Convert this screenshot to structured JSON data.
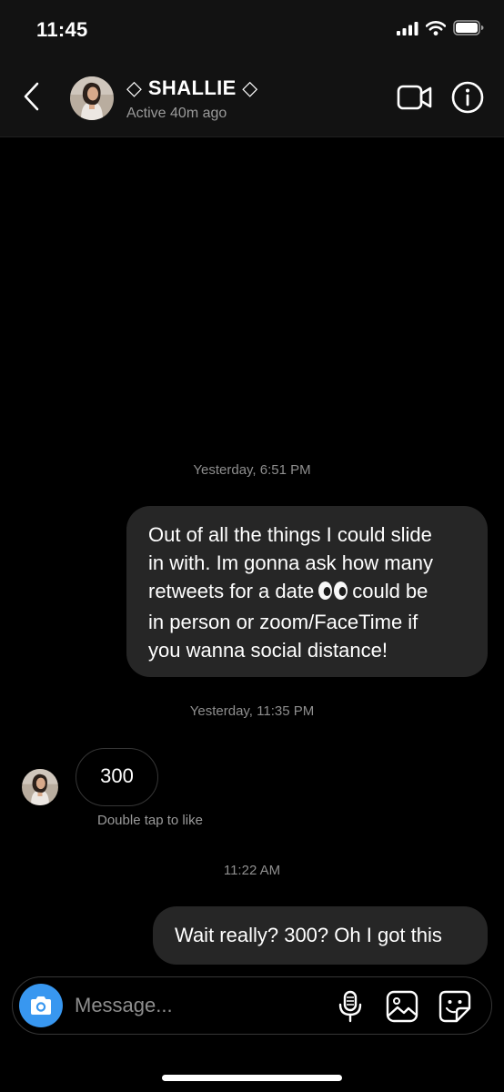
{
  "status_bar": {
    "time": "11:45",
    "icons": [
      "cellular-signal-icon",
      "wifi-icon",
      "battery-icon"
    ]
  },
  "header": {
    "back_icon": "chevron-left-icon",
    "name": "◇ SHALLIE ◇",
    "status": "Active 40m ago",
    "video_icon": "video-camera-icon",
    "info_icon": "info-icon"
  },
  "conversation": {
    "timestamps": [
      "Yesterday, 6:51 PM",
      "Yesterday, 11:35 PM",
      "11:22 AM"
    ],
    "messages": [
      {
        "sender": "me",
        "lines": [
          "Out of all the things I could slide",
          "in with. Im gonna ask how many",
          "retweets for a date",
          "could be",
          "in person or zoom/FaceTime if",
          "you wanna social distance!"
        ],
        "emoji": "eyes-emoji"
      },
      {
        "sender": "them",
        "text": "300",
        "hint": "Double tap to like"
      },
      {
        "sender": "me",
        "text": "Wait really? 300? Oh I got this"
      }
    ]
  },
  "composer": {
    "camera_icon": "camera-icon",
    "placeholder": "Message...",
    "mic_icon": "microphone-icon",
    "gallery_icon": "gallery-icon",
    "sticker_icon": "sticker-icon"
  },
  "colors": {
    "background": "#000000",
    "bar_background": "#121212",
    "sent_bubble": "#262626",
    "received_border": "#363636",
    "accent": "#3897f0",
    "muted_text": "#8e8e8e"
  }
}
